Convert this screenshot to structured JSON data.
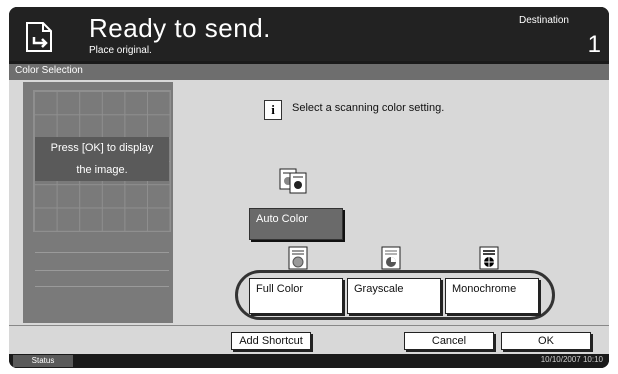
{
  "header": {
    "title": "Ready to send.",
    "subtitle": "Place original.",
    "destination_label": "Destination",
    "destination_count": "1"
  },
  "section": {
    "title": "Color Selection"
  },
  "preview": {
    "message_line1": "Press [OK] to display",
    "message_line2": "the image."
  },
  "instruction": {
    "text": "Select a scanning color setting."
  },
  "options": {
    "auto": "Auto Color",
    "full": "Full Color",
    "gray": "Grayscale",
    "mono": "Monochrome"
  },
  "footer": {
    "add_shortcut": "Add Shortcut",
    "cancel": "Cancel",
    "ok": "OK"
  },
  "status": {
    "label": "Status",
    "datetime": "10/10/2007  10:10"
  },
  "icons": {
    "header": "send-document-icon",
    "info": "info-icon",
    "auto": "auto-color-icon",
    "full": "full-color-icon",
    "gray": "grayscale-icon",
    "mono": "monochrome-icon"
  },
  "colors": {
    "selected_button": "#6a6a6a",
    "background": "#d8d8d8",
    "header": "#222222"
  }
}
